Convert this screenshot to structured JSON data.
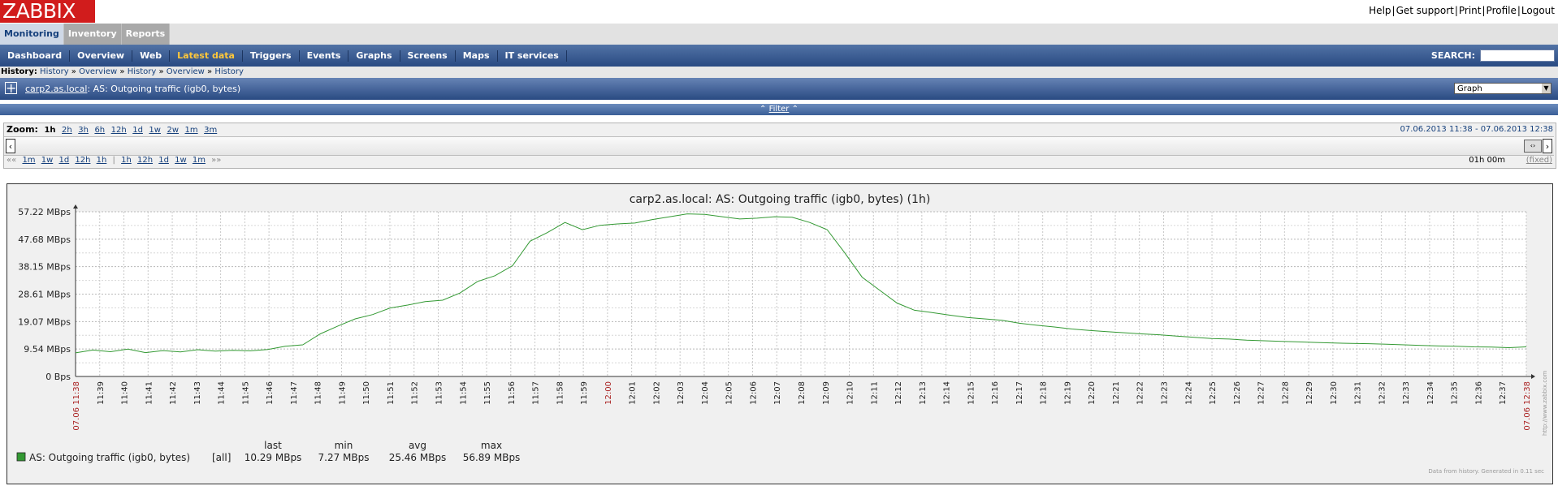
{
  "app": {
    "logo": "ZABBIX"
  },
  "top_links": [
    "Help",
    "Get support",
    "Print",
    "Profile",
    "Logout"
  ],
  "main_tabs": [
    "Monitoring",
    "Inventory",
    "Reports"
  ],
  "sub_nav": [
    "Dashboard",
    "Overview",
    "Web",
    "Latest data",
    "Triggers",
    "Events",
    "Graphs",
    "Screens",
    "Maps",
    "IT services"
  ],
  "sub_nav_active": "Latest data",
  "search": {
    "label": "SEARCH:",
    "value": ""
  },
  "history": {
    "label": "History:",
    "items": [
      "History",
      "Overview",
      "History",
      "Overview",
      "History"
    ]
  },
  "title": {
    "host": "carp2.as.local",
    "item": ": AS: Outgoing traffic (igb0, bytes)",
    "view": "Graph"
  },
  "filter": {
    "label": "Filter"
  },
  "zoom": {
    "label": "Zoom:",
    "options": [
      "1h",
      "2h",
      "3h",
      "6h",
      "12h",
      "1d",
      "1w",
      "2w",
      "1m",
      "3m"
    ],
    "current": "1h",
    "range": "07.06.2013 11:38  -  07.06.2013 12:38",
    "back": [
      "««",
      "1m",
      "1w",
      "1d",
      "12h",
      "1h"
    ],
    "forward": [
      "1h",
      "12h",
      "1d",
      "1w",
      "1m",
      "»»"
    ],
    "period": "01h 00m",
    "fixed": "(fixed)"
  },
  "colors": {
    "series": "#339933",
    "accent": "#cc3333",
    "nav": "#294a82"
  },
  "chart_data": {
    "type": "line",
    "title": "carp2.as.local: AS: Outgoing traffic (igb0, bytes)  (1h)",
    "y_ticks": [
      "0 Bps",
      "9.54 MBps",
      "19.07 MBps",
      "28.61 MBps",
      "38.15 MBps",
      "47.68 MBps",
      "57.22 MBps"
    ],
    "ylim": [
      0,
      57.22
    ],
    "x_start_label": "07.06 11:38",
    "x_end_label": "07.06 12:38",
    "x_ticks": [
      "11:39",
      "11:40",
      "11:41",
      "11:42",
      "11:43",
      "11:44",
      "11:45",
      "11:46",
      "11:47",
      "11:48",
      "11:49",
      "11:50",
      "11:51",
      "11:52",
      "11:53",
      "11:54",
      "11:55",
      "11:56",
      "11:57",
      "11:58",
      "11:59",
      "12:00",
      "12:01",
      "12:02",
      "12:03",
      "12:04",
      "12:05",
      "12:06",
      "12:07",
      "12:08",
      "12:09",
      "12:10",
      "12:11",
      "12:12",
      "12:13",
      "12:14",
      "12:15",
      "12:16",
      "12:17",
      "12:18",
      "12:19",
      "12:20",
      "12:21",
      "12:22",
      "12:23",
      "12:24",
      "12:25",
      "12:26",
      "12:27",
      "12:28",
      "12:29",
      "12:30",
      "12:31",
      "12:32",
      "12:33",
      "12:34",
      "12:35",
      "12:36",
      "12:37"
    ],
    "highlight_tick": "12:00",
    "series": [
      {
        "name": "AS: Outgoing traffic (igb0, bytes)",
        "values": [
          8.2,
          9.2,
          8.6,
          9.5,
          8.3,
          9.0,
          8.5,
          9.3,
          8.8,
          9.1,
          8.9,
          9.4,
          10.5,
          11.0,
          14.8,
          17.5,
          20.0,
          21.5,
          23.8,
          24.8,
          26.0,
          26.5,
          29.0,
          33.0,
          35.0,
          38.5,
          47.0,
          50.0,
          53.5,
          51.0,
          52.5,
          53.0,
          53.3,
          54.5,
          55.5,
          56.5,
          56.3,
          55.5,
          54.7,
          55.0,
          55.5,
          55.3,
          53.5,
          51.0,
          43.0,
          34.5,
          30.0,
          25.5,
          23.0,
          22.2,
          21.3,
          20.5,
          20.0,
          19.5,
          18.5,
          17.8,
          17.2,
          16.5,
          16.0,
          15.6,
          15.2,
          14.8,
          14.5,
          14.0,
          13.6,
          13.2,
          13.0,
          12.6,
          12.4,
          12.2,
          12.0,
          11.8,
          11.6,
          11.5,
          11.4,
          11.2,
          11.0,
          10.8,
          10.6,
          10.5,
          10.3,
          10.2,
          10.0,
          10.3
        ]
      }
    ],
    "legend": {
      "headers": [
        "last",
        "min",
        "avg",
        "max"
      ],
      "row": {
        "name": "AS: Outgoing traffic (igb0, bytes)",
        "func": "[all]",
        "last": "10.29 MBps",
        "min": "7.27 MBps",
        "avg": "25.46 MBps",
        "max": "56.89 MBps"
      }
    },
    "footer": "Data from history. Generated in 0.11 sec",
    "watermark": "http://www.zabbix.com"
  }
}
